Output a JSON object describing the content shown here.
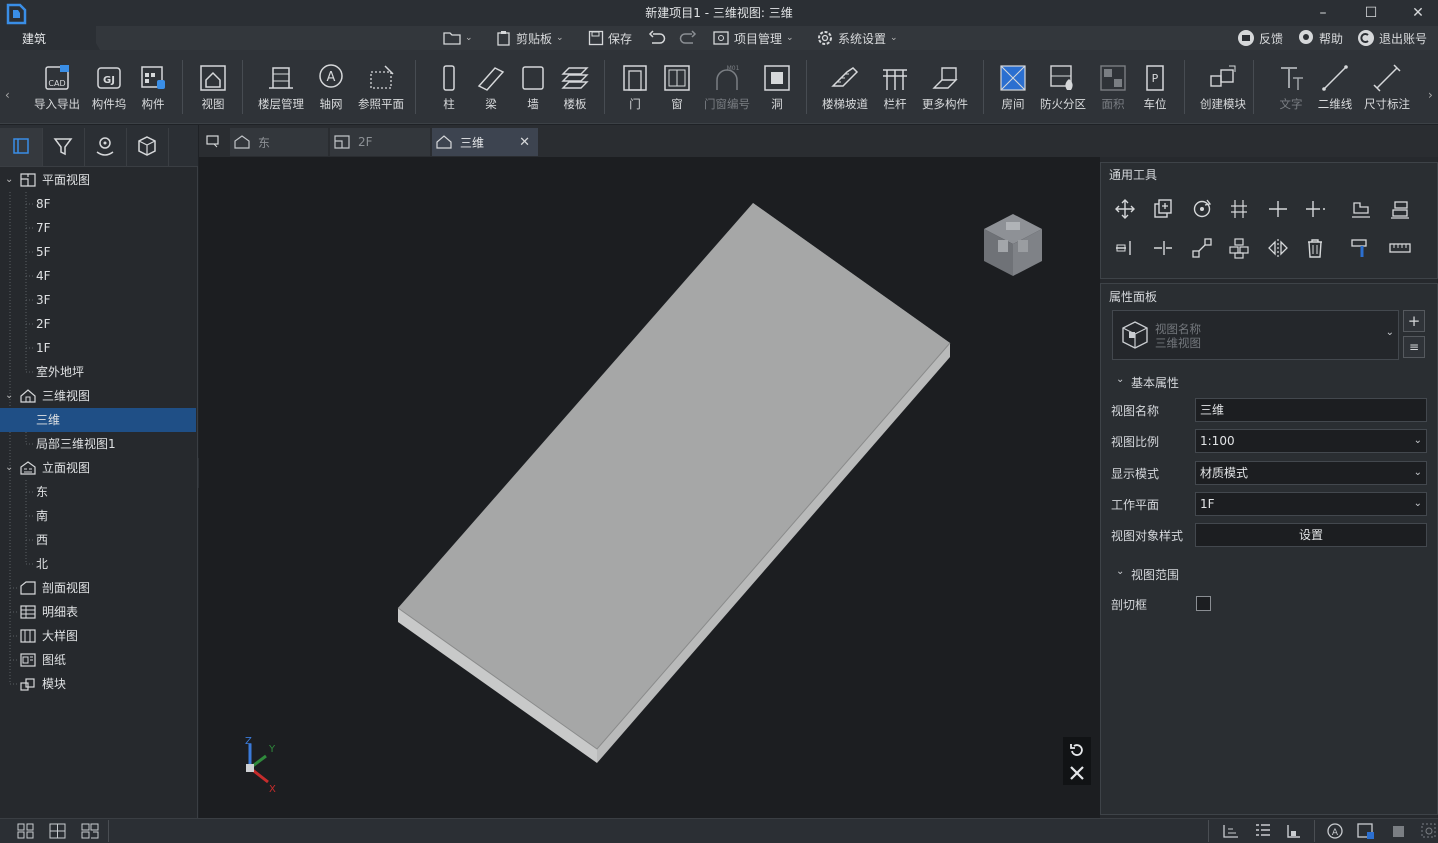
{
  "app": {
    "title": "新建项目1 - 三维视图: 三维",
    "module_tab": "建筑"
  },
  "quick_access": {
    "clipboard": "剪贴板",
    "save": "保存",
    "project_mgmt": "项目管理",
    "system_settings": "系统设置",
    "feedback": "反馈",
    "help": "帮助",
    "logout": "退出账号"
  },
  "ribbon": {
    "buttons": [
      {
        "id": "import-export",
        "label": "导入导出"
      },
      {
        "id": "component-dock",
        "label": "构件坞"
      },
      {
        "id": "component",
        "label": "构件"
      },
      {
        "id": "view",
        "label": "视图"
      },
      {
        "id": "floor-mgmt",
        "label": "楼层管理"
      },
      {
        "id": "axis-grid",
        "label": "轴网"
      },
      {
        "id": "ref-plane",
        "label": "参照平面"
      },
      {
        "id": "column",
        "label": "柱"
      },
      {
        "id": "beam",
        "label": "梁"
      },
      {
        "id": "wall",
        "label": "墙"
      },
      {
        "id": "slab",
        "label": "楼板"
      },
      {
        "id": "door",
        "label": "门"
      },
      {
        "id": "window",
        "label": "窗"
      },
      {
        "id": "door-window-no",
        "label": "门窗编号"
      },
      {
        "id": "opening",
        "label": "洞"
      },
      {
        "id": "stair-ramp",
        "label": "楼梯坡道"
      },
      {
        "id": "railing",
        "label": "栏杆"
      },
      {
        "id": "more-components",
        "label": "更多构件"
      },
      {
        "id": "room",
        "label": "房间"
      },
      {
        "id": "fire-zone",
        "label": "防火分区"
      },
      {
        "id": "area",
        "label": "面积"
      },
      {
        "id": "parking",
        "label": "车位"
      },
      {
        "id": "create-module",
        "label": "创建模块"
      },
      {
        "id": "text",
        "label": "文字"
      },
      {
        "id": "2d-line",
        "label": "二维线"
      },
      {
        "id": "dimension",
        "label": "尺寸标注"
      }
    ]
  },
  "tree": {
    "plan_views": "平面视图",
    "floors": [
      "8F",
      "7F",
      "5F",
      "4F",
      "3F",
      "2F",
      "1F",
      "室外地坪"
    ],
    "three_d_views": "三维视图",
    "three_d_items": [
      "三维",
      "局部三维视图1"
    ],
    "elevation_views": "立面视图",
    "elevations": [
      "东",
      "南",
      "西",
      "北"
    ],
    "section_views": "剖面视图",
    "schedule": "明细表",
    "detail": "大样图",
    "sheets": "图纸",
    "modules": "模块"
  },
  "doc_tabs": [
    {
      "label": "东"
    },
    {
      "label": "2F"
    },
    {
      "label": "三维"
    }
  ],
  "axis": {
    "x": "X",
    "y": "Y",
    "z": "Z"
  },
  "tools_panel": {
    "title": "通用工具"
  },
  "props_panel": {
    "title": "属性面板",
    "type_name": "视图名称",
    "type_value": "三维视图",
    "basic_section": "基本属性",
    "view_name_label": "视图名称",
    "view_name_value": "三维",
    "scale_label": "视图比例",
    "scale_value": "1:100",
    "display_label": "显示模式",
    "display_value": "材质模式",
    "workplane_label": "工作平面",
    "workplane_value": "1F",
    "style_label": "视图对象样式",
    "style_button": "设置",
    "range_section": "视图范围",
    "section_box_label": "剖切框"
  },
  "colors": {
    "accent": "#1f4f86",
    "slab_top": "#a6a7a7",
    "slab_side": "#c8c9c9"
  }
}
